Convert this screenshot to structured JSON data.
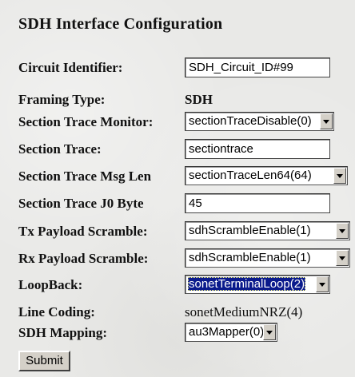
{
  "page_title": "SDH Interface Configuration",
  "fields": [
    {
      "label": "Circuit Identifier:",
      "kind": "text",
      "value": "SDH_Circuit_ID#99"
    },
    {
      "label": "Framing Type:",
      "kind": "static-bold",
      "value": "SDH"
    },
    {
      "label": "Section Trace Monitor:",
      "kind": "select",
      "value": "sectionTraceDisable(0)"
    },
    {
      "label": "Section Trace:",
      "kind": "text",
      "value": "sectiontrace"
    },
    {
      "label": "Section Trace Msg Len",
      "kind": "select",
      "value": "sectionTraceLen64(64)"
    },
    {
      "label": "Section Trace J0 Byte",
      "kind": "text",
      "value": "45"
    },
    {
      "label": "Tx Payload Scramble:",
      "kind": "select",
      "value": "sdhScrambleEnable(1)"
    },
    {
      "label": "Rx Payload Scramble:",
      "kind": "select",
      "value": "sdhScrambleEnable(1)"
    },
    {
      "label": "LoopBack:",
      "kind": "select",
      "value": "sonetTerminalLoop(2)",
      "focused": true
    },
    {
      "label": "Line Coding:",
      "kind": "static",
      "value": "sonetMediumNRZ(4)"
    },
    {
      "label": "SDH Mapping:",
      "kind": "select",
      "value": "au3Mapper(0)"
    }
  ],
  "submit_label": "Submit",
  "colors": {
    "background": "#e9e9e7",
    "focus_highlight": "#0a1a8c",
    "button_face": "#d4d0c8"
  },
  "icons": {
    "dropdown": "chevron-down-icon"
  }
}
